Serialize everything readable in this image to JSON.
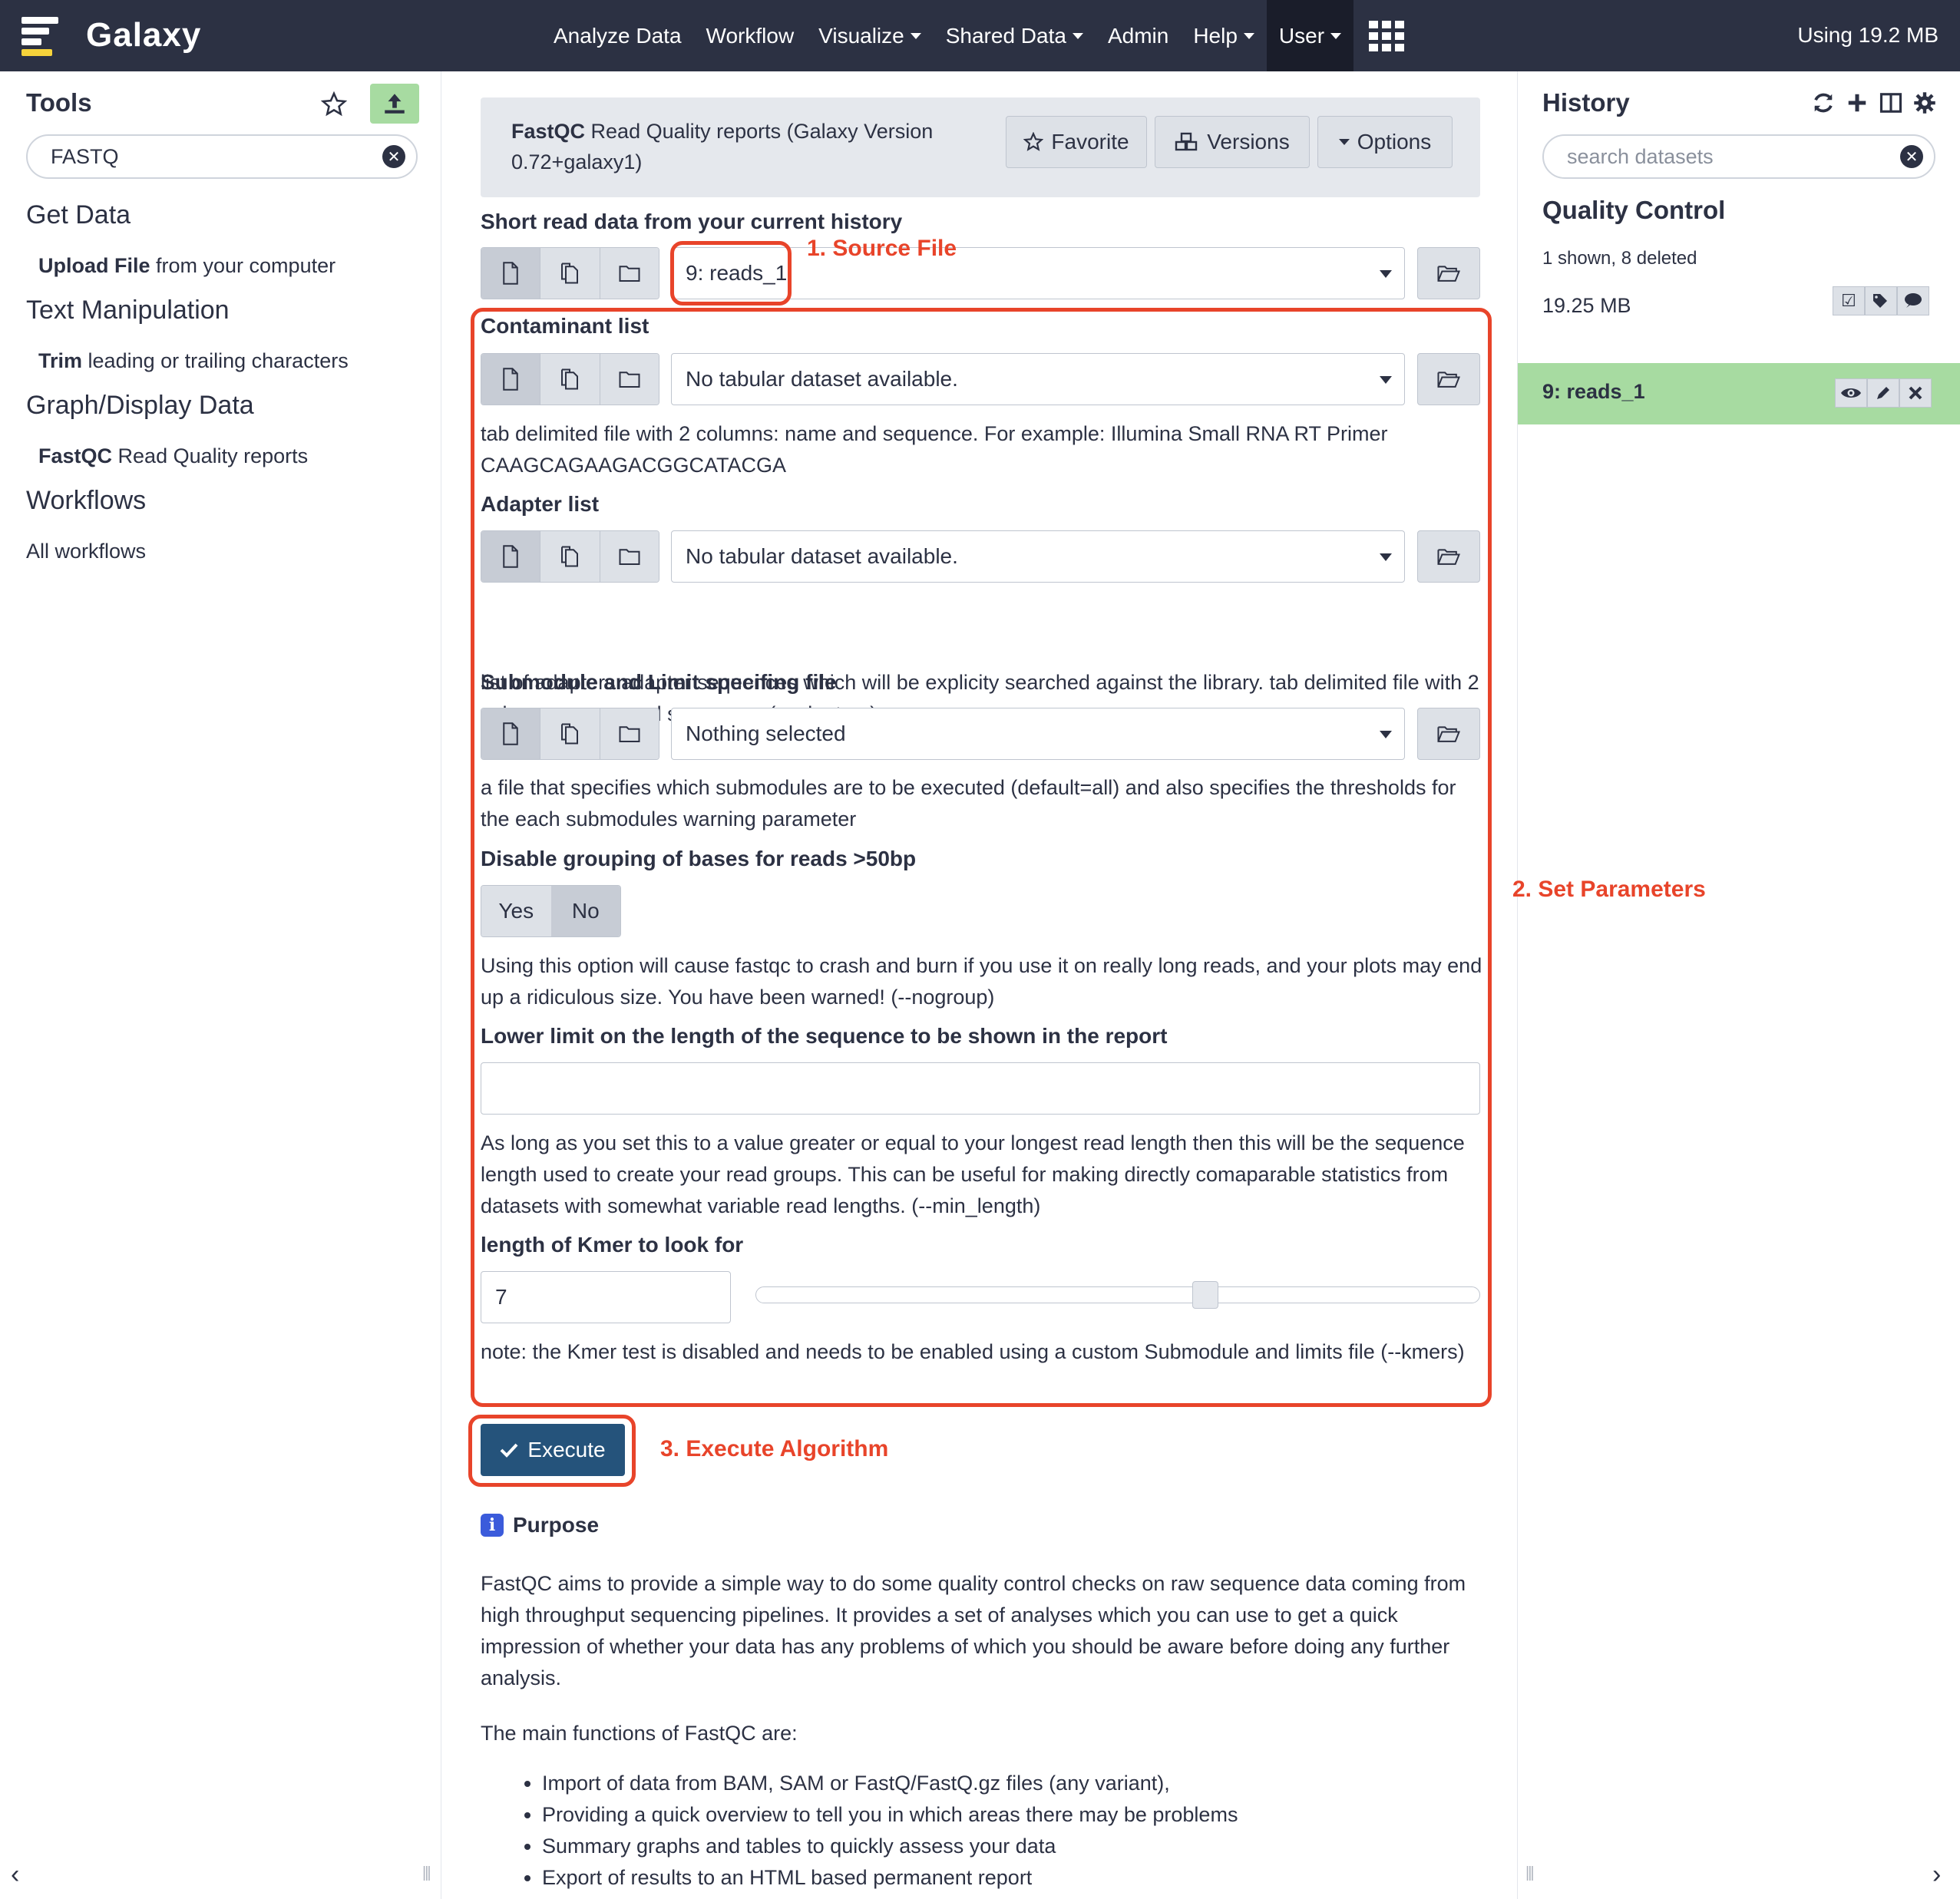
{
  "masthead": {
    "brand": "Galaxy",
    "nav": [
      {
        "label": "Analyze Data",
        "dropdown": false
      },
      {
        "label": "Workflow",
        "dropdown": false
      },
      {
        "label": "Visualize",
        "dropdown": true
      },
      {
        "label": "Shared Data",
        "dropdown": true
      },
      {
        "label": "Admin",
        "dropdown": false
      },
      {
        "label": "Help",
        "dropdown": true
      },
      {
        "label": "User",
        "dropdown": true,
        "active": true
      }
    ],
    "apps_icon": "grid-icon",
    "usage": "Using 19.2 MB"
  },
  "tools": {
    "title": "Tools",
    "search_value": "FASTQ",
    "sections": [
      {
        "title": "Get Data",
        "items": [
          {
            "name": "Upload File",
            "desc": " from your computer"
          }
        ]
      },
      {
        "title": "Text Manipulation",
        "items": [
          {
            "name": "Trim",
            "desc": " leading or trailing characters"
          }
        ]
      },
      {
        "title": "Graph/Display Data",
        "items": [
          {
            "name": "FastQC",
            "desc": " Read Quality reports"
          }
        ]
      },
      {
        "title": "Workflows",
        "items": [
          {
            "name": "",
            "desc": "All workflows"
          }
        ]
      }
    ]
  },
  "tool_form": {
    "title_bold": "FastQC",
    "title_rest": " Read Quality reports (Galaxy Version 0.72+galaxy1)",
    "favorite": "Favorite",
    "versions": "Versions",
    "options": "Options",
    "input_label": "Short read data from your current history",
    "input_value": "9: reads_1",
    "contaminant_label": "Contaminant list",
    "contaminant_value": "No tabular dataset available.",
    "contaminant_help": "tab delimited file with 2 columns: name and sequence. For example: Illumina Small RNA RT Primer CAAGCAGAAGACGGCATACGA",
    "adapter_label": "Adapter list",
    "adapter_value": "No tabular dataset available.",
    "adapter_help": "list of adapters adapter sequences which will be explicity searched against the library. tab delimited file with 2 columns: name and sequence. (--adapters)",
    "submodule_label": "Submodule and Limit specifing file",
    "submodule_value": "Nothing selected",
    "submodule_help": "a file that specifies which submodules are to be executed (default=all) and also specifies the thresholds for the each submodules warning parameter",
    "nogroup_label": "Disable grouping of bases for reads >50bp",
    "nogroup_yes": "Yes",
    "nogroup_no": "No",
    "nogroup_selected": "No",
    "nogroup_help": "Using this option will cause fastqc to crash and burn if you use it on really long reads, and your plots may end up a ridiculous size. You have been warned! (--nogroup)",
    "minlen_label": "Lower limit on the length of the sequence to be shown in the report",
    "minlen_value": "",
    "minlen_help": "As long as you set this to a value greater or equal to your longest read length then this will be the sequence length used to create your read groups. This can be useful for making directly comaparable statistics from datasets with somewhat variable read lengths. (--min_length)",
    "kmer_label": "length of Kmer to look for",
    "kmer_value": "7",
    "kmer_slider_fraction": 0.625,
    "kmer_help": "note: the Kmer test is disabled and needs to be enabled using a custom Submodule and limits file (--kmers)",
    "execute": "Execute"
  },
  "annotations": {
    "step1": "1. Source File",
    "step2": "2. Set Parameters",
    "step3": "3. Execute Algorithm",
    "color": "#e8442a"
  },
  "help": {
    "purpose_title": "Purpose",
    "purpose_text": "FastQC aims to provide a simple way to do some quality control checks on raw sequence data coming from high throughput sequencing pipelines. It provides a set of analyses which you can use to get a quick impression of whether your data has any problems of which you should be aware before doing any further analysis.",
    "functions_intro": "The main functions of FastQC are:",
    "functions": [
      "Import of data from BAM, SAM or FastQ/FastQ.gz files (any variant),",
      "Providing a quick overview to tell you in which areas there may be problems",
      "Summary graphs and tables to quickly assess your data",
      "Export of results to an HTML based permanent report"
    ]
  },
  "history": {
    "title": "History",
    "search_placeholder": "search datasets",
    "name": "Quality Control",
    "summary": "1 shown, 8 deleted",
    "size": "19.25 MB",
    "dataset": "9: reads_1",
    "dataset_state_color": "#a7dba1"
  },
  "colors": {
    "masthead": "#2c3143",
    "execute": "#25537b",
    "annotation": "#e8442a"
  }
}
